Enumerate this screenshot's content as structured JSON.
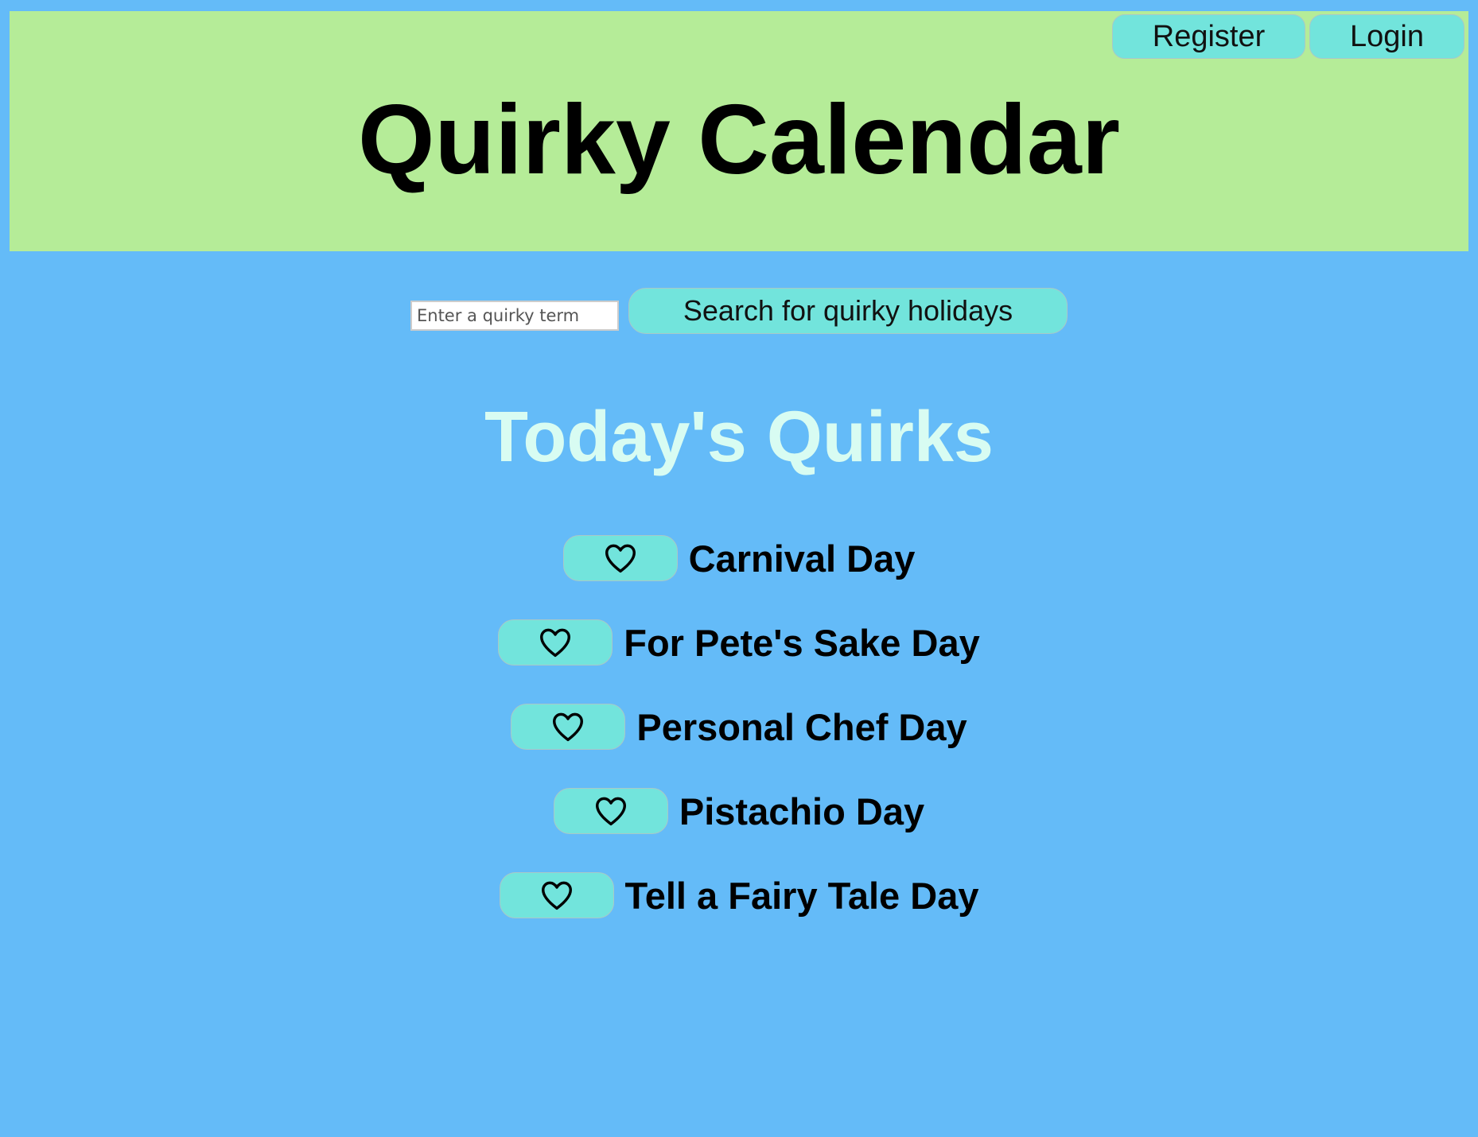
{
  "header": {
    "title": "Quirky Calendar",
    "register_label": "Register",
    "login_label": "Login"
  },
  "search": {
    "placeholder": "Enter a quirky term",
    "value": "",
    "button_label": "Search for quirky holidays"
  },
  "today": {
    "title": "Today's Quirks",
    "favorite_icon": "heart-outline-icon",
    "items": [
      {
        "name": "Carnival Day"
      },
      {
        "name": "For Pete's Sake Day"
      },
      {
        "name": "Personal Chef Day"
      },
      {
        "name": "Pistachio Day"
      },
      {
        "name": "Tell a Fairy Tale Day"
      }
    ]
  },
  "colors": {
    "page_background": "#64bbf8",
    "header_background": "#b5ec98",
    "button_background": "#72e4dc",
    "section_title": "#d8fcf2"
  }
}
